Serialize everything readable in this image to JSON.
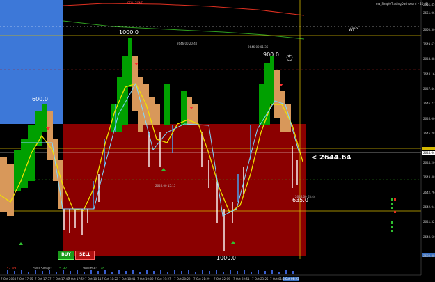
{
  "indicator_name": "ma_SimpleTradingDashboard • 20 (1)",
  "top_label": "SELL ZONE",
  "pivot_label": "WPP",
  "price_readout": "< 2644.64",
  "swing_labels": [
    "600.0",
    "1000.0",
    "900.0",
    "635.0",
    "1000.0"
  ],
  "timestamps": [
    "2646.00 20:40",
    "2646.00 01:36",
    "2646.00 15:15",
    "2646.00 03:44"
  ],
  "circle_badge": "4",
  "buttons": {
    "buy": "BUY",
    "sell": "SELL"
  },
  "status_bar": {
    "left_value": "32.89",
    "sell_swap_label": "Sell Swap:",
    "sell_swap_value": "15.92",
    "volume_label": "Volume:",
    "volume_value": "78"
  },
  "price_axis": [
    "2651.45",
    "2651.06",
    "2650.30",
    "2649.62",
    "2648.88",
    "2648.16",
    "2647.44",
    "2646.72",
    "2646.00",
    "2645.28",
    "2644.64",
    "2644.20",
    "2643.48",
    "2642.76",
    "2642.04",
    "2641.32",
    "2640.60",
    "2639.88"
  ],
  "time_axis": [
    "7 Oct 2024",
    "7 Oct 17:05",
    "7 Oct 17:37",
    "7 Oct 17:49",
    "7 Oct 17:59",
    "7 Oct 18:11",
    "7 Oct 18:22",
    "7 Oct 18:41",
    "7 Oct 19:00",
    "7 Oct 19:27",
    "7 Oct 20:22",
    "7 Oct 21:29",
    "7 Oct 22:09",
    "7 Oct 22:51",
    "7 Oct 23:25",
    "7 Oct 01:35",
    "8 Oct 06:23"
  ],
  "colors": {
    "background": "#000000",
    "buy_zone": "#3d78d8",
    "sell_zone": "#8b0000",
    "bull_candle": "#00a000",
    "bear_candle": "#d8985a",
    "ma_line": "#f0e000",
    "signal_line": "#44aaff",
    "accent_yellow": "#d4b800"
  }
}
